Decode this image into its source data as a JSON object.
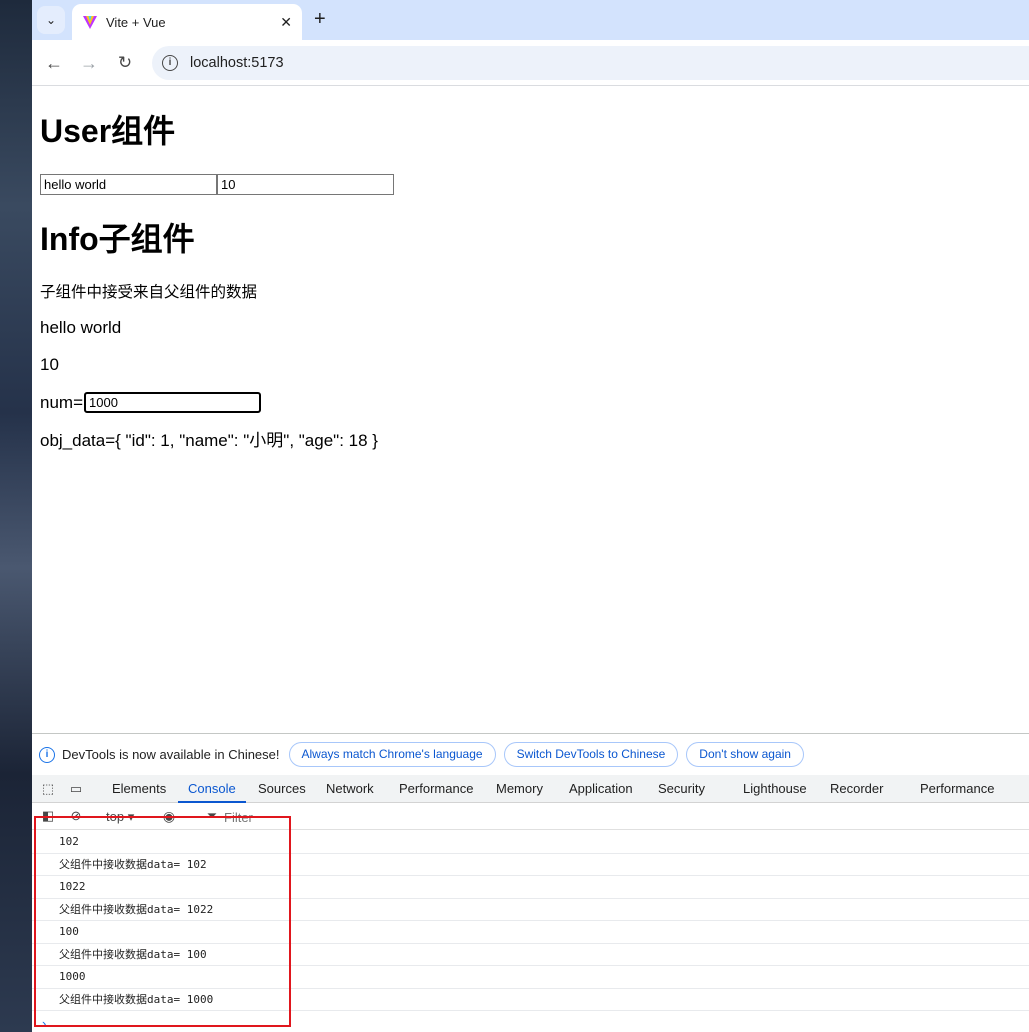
{
  "browser": {
    "tab_title": "Vite + Vue",
    "url": "localhost:5173"
  },
  "page": {
    "user_title": "User组件",
    "msg_value": "hello world",
    "num_value": "10",
    "info_title": "Info子组件",
    "info_desc": "子组件中接受来自父组件的数据",
    "info_msg": "hello world",
    "info_num": "10",
    "num_label": "num=",
    "num_input_value": "1000",
    "obj_text": "obj_data={ \"id\": 1, \"name\": \"小明\", \"age\": 18 }"
  },
  "devtools": {
    "infobar": {
      "text": "DevTools is now available in Chinese!",
      "btn_match": "Always match Chrome's language",
      "btn_switch": "Switch DevTools to Chinese",
      "btn_dismiss": "Don't show again"
    },
    "tabs": [
      "Elements",
      "Console",
      "Sources",
      "Network",
      "Performance",
      "Memory",
      "Application",
      "Security",
      "Lighthouse",
      "Recorder",
      "Performance insigh"
    ],
    "active_tab": "Console",
    "context": "top",
    "filter_placeholder": "Filter",
    "logs": [
      "102",
      "父组件中接收数据data= 102",
      "1022",
      "父组件中接收数据data= 1022",
      "100",
      "父组件中接收数据data= 100",
      "1000",
      "父组件中接收数据data= 1000"
    ]
  },
  "colors": {
    "accent": "#0b57d0",
    "highlight_border": "#e0161d",
    "tabbar_bg": "#d3e3fd"
  }
}
